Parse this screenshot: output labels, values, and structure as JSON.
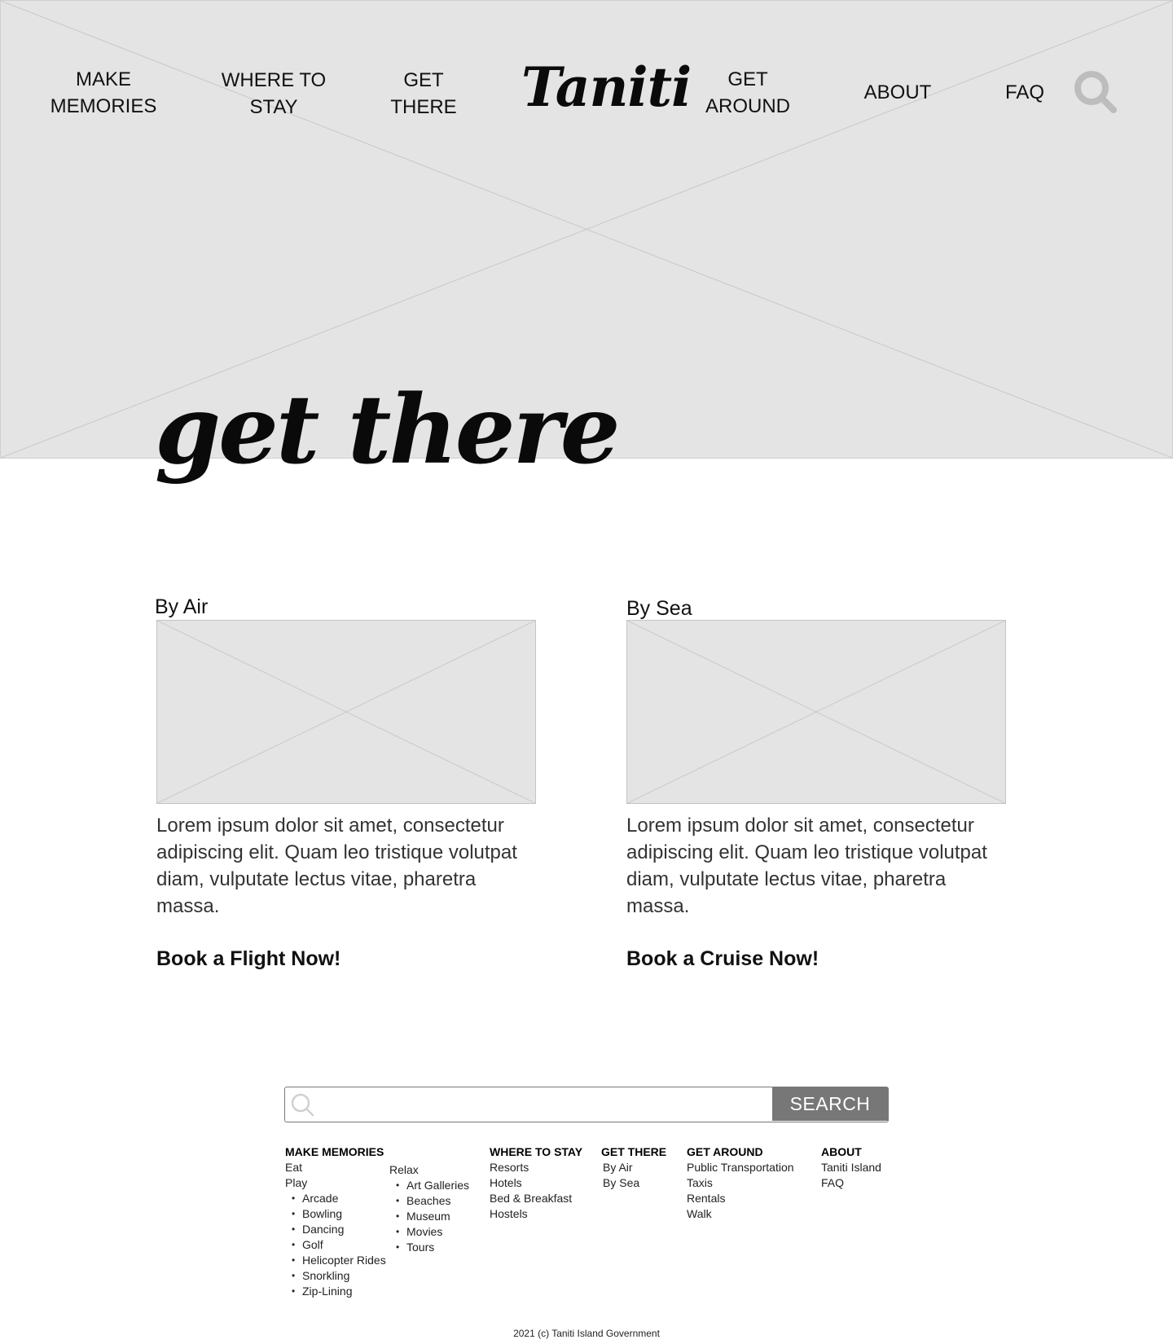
{
  "nav": {
    "left": [
      "MAKE\nMEMORIES",
      "WHERE TO\nSTAY",
      "GET\nTHERE"
    ],
    "logo": "Taniti",
    "right": [
      "GET\nAROUND",
      "ABOUT",
      "FAQ"
    ],
    "search_icon": "search-icon"
  },
  "page": {
    "title": "get there"
  },
  "cards": [
    {
      "title": "By Air",
      "text": "Lorem ipsum dolor sit amet, consectetur adipiscing elit. Quam leo tristique volutpat diam, vulputate lectus vitae, pharetra massa.",
      "cta": "Book a Flight Now!"
    },
    {
      "title": "By Sea",
      "text": "Lorem ipsum dolor sit amet, consectetur adipiscing elit. Quam leo tristique volutpat diam, vulputate lectus vitae, pharetra massa.",
      "cta": "Book a Cruise Now!"
    }
  ],
  "footer": {
    "search": {
      "placeholder": "",
      "button": "SEARCH"
    },
    "make_memories": {
      "heading": "MAKE MEMORIES",
      "eat": "Eat",
      "play": "Play",
      "play_items": [
        "Arcade",
        "Bowling",
        "Dancing",
        "Golf",
        "Helicopter Rides",
        "Snorkling",
        "Zip-Lining"
      ],
      "relax": "Relax",
      "relax_items": [
        "Art Galleries",
        "Beaches",
        "Museum",
        "Movies",
        "Tours"
      ]
    },
    "where_to_stay": {
      "heading": "WHERE TO STAY",
      "items": [
        "Resorts",
        "Hotels",
        "Bed & Breakfast",
        "Hostels"
      ]
    },
    "get_there": {
      "heading": "GET THERE",
      "items": [
        "By Air",
        "By Sea"
      ]
    },
    "get_around": {
      "heading": "GET AROUND",
      "items": [
        "Public Transportation",
        "Taxis",
        "Rentals",
        "Walk"
      ]
    },
    "about": {
      "heading": "ABOUT",
      "items": [
        "Taniti Island",
        "FAQ"
      ]
    },
    "copyright": "2021 (c) Taniti Island Government"
  }
}
